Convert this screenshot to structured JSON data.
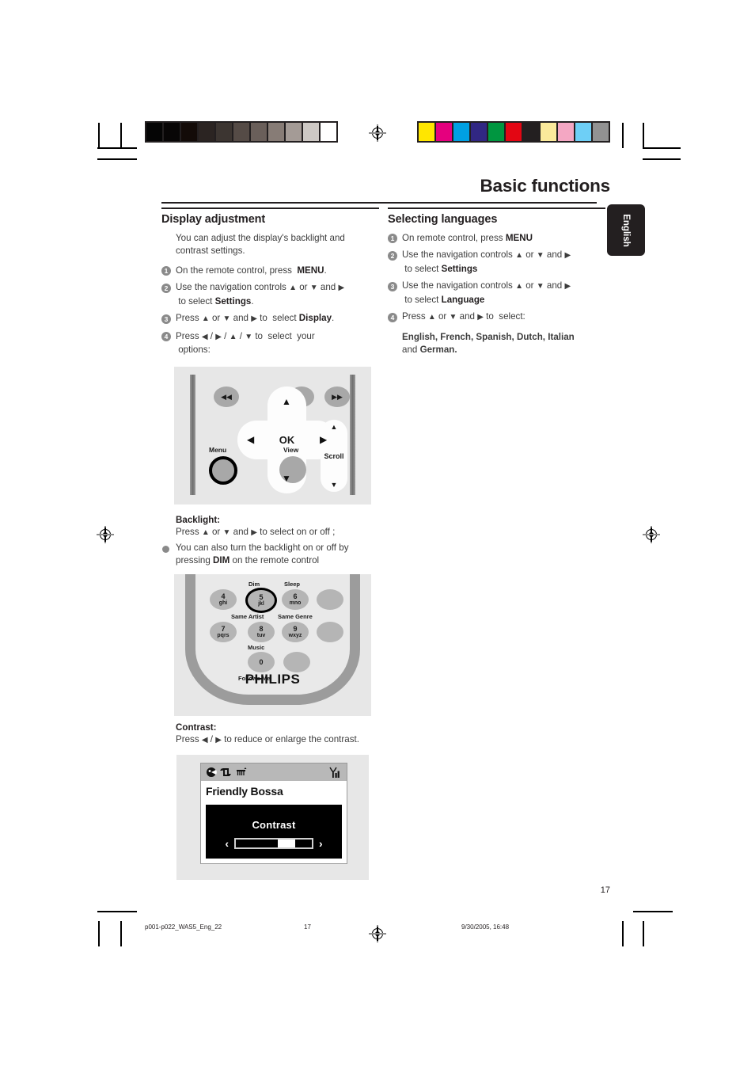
{
  "header": {
    "page_title": "Basic functions",
    "language_tab": "English"
  },
  "left_column": {
    "heading": "Display adjustment",
    "intro": "You can adjust the display's backlight and contrast settings.",
    "steps": [
      {
        "num": "1",
        "html": "On the remote control, press&nbsp; <b>MENU</b>."
      },
      {
        "num": "2",
        "html": "Use the navigation controls <span class=\"arrow\">▲</span> or <span class=\"arrow\">▼</span> and <span class=\"arrow\">▶</span><br>&nbsp;to select <b>Settings</b>."
      },
      {
        "num": "3",
        "html": "Press <span class=\"arrow\">▲</span> or <span class=\"arrow\">▼</span> and <span class=\"arrow\">▶</span> to&nbsp; select <b>Display</b>."
      },
      {
        "num": "4",
        "html": "Press <span class=\"arrow\">◀</span> / <span class=\"arrow\">▶</span> / <span class=\"arrow\">▲</span> / <span class=\"arrow\">▼</span> to&nbsp; select&nbsp; your<br>&nbsp;options:"
      }
    ],
    "backlight": {
      "heading": "Backlight:",
      "line": "Press <span class=\"arrow\">▲</span> or <span class=\"arrow\">▼</span> and <span class=\"arrow\">▶</span> to select on or off ;",
      "bullet": "You can also turn the backlight on or off by pressing <b>DIM</b> on the remote control"
    },
    "contrast": {
      "heading": "Contrast:",
      "line": "Press <span class=\"arrow\">◀</span> / <span class=\"arrow\">▶</span> to reduce or enlarge the contrast."
    }
  },
  "right_column": {
    "heading": "Selecting languages",
    "steps": [
      {
        "num": "1",
        "html": "On remote control, press <b>MENU</b>"
      },
      {
        "num": "2",
        "html": "Use the navigation controls <span class=\"arrow\">▲</span> or <span class=\"arrow\">▼</span> and <span class=\"arrow\">▶</span><br>&nbsp;to select <b>Settings</b>"
      },
      {
        "num": "3",
        "html": "Use the navigation controls <span class=\"arrow\">▲</span> or <span class=\"arrow\">▼</span> and <span class=\"arrow\">▶</span><br>&nbsp;to select <b>Language</b>"
      },
      {
        "num": "4",
        "html": "Press <span class=\"arrow\">▲</span> or <span class=\"arrow\">▼</span> and <span class=\"arrow\">▶</span> to&nbsp; select:"
      }
    ],
    "languages_html": "English, French, Spanish, Dutch, Italian<br><span class=\"reg\">and</span> German."
  },
  "figure_navpad": {
    "buttons": {
      "rewind": "◀◀",
      "stop": "■",
      "forward": "▶▶",
      "ok": "OK",
      "up": "▲",
      "down": "▼",
      "left": "◀",
      "right": "▶"
    },
    "labels": {
      "menu": "Menu",
      "view": "View",
      "scroll": "Scroll",
      "scroll_up": "▲",
      "scroll_down": "▼"
    }
  },
  "figure_keypad": {
    "keys": [
      {
        "n": "4",
        "a": "ghi"
      },
      {
        "n": "5",
        "a": "jkl"
      },
      {
        "n": "6",
        "a": "mno"
      },
      {
        "n": "7",
        "a": "pqrs"
      },
      {
        "n": "8",
        "a": "tuv"
      },
      {
        "n": "9",
        "a": "wxyz"
      },
      {
        "n": "0",
        "a": ""
      }
    ],
    "labels": {
      "dim": "Dim",
      "sleep": "Sleep",
      "same_artist": "Same Artist",
      "same_genre": "Same Genre",
      "music": "Music",
      "follows_me": "Follows Me"
    },
    "brand": "PHILIPS"
  },
  "figure_lcd": {
    "title": "Friendly Bossa",
    "menu_label": "Contrast",
    "left_chevron": "‹",
    "right_chevron": "›",
    "slider_percent": 78,
    "status_icons": [
      "shuffle-icon",
      "repeat-icon",
      "antenna-small-icon",
      "signal-strength-icon"
    ]
  },
  "footer": {
    "page_number": "17",
    "file_name": "p001-p022_WAS5_Eng_22",
    "foot_page": "17",
    "timestamp": "9/30/2005, 16:48"
  },
  "print_marks": {
    "greyscale_swatches": [
      "#050505",
      "#080606",
      "#130b08",
      "#2b2422",
      "#3c3531",
      "#554b46",
      "#6a5f5a",
      "#877c76",
      "#a49b96",
      "#cdc8c4",
      "#ffffff"
    ],
    "color_swatches": [
      "#ffe600",
      "#e5007e",
      "#00a0e3",
      "#312783",
      "#009640",
      "#e30613",
      "#231f20",
      "#fbea9b",
      "#f4a7c3",
      "#6ecff6",
      "#929292"
    ]
  }
}
